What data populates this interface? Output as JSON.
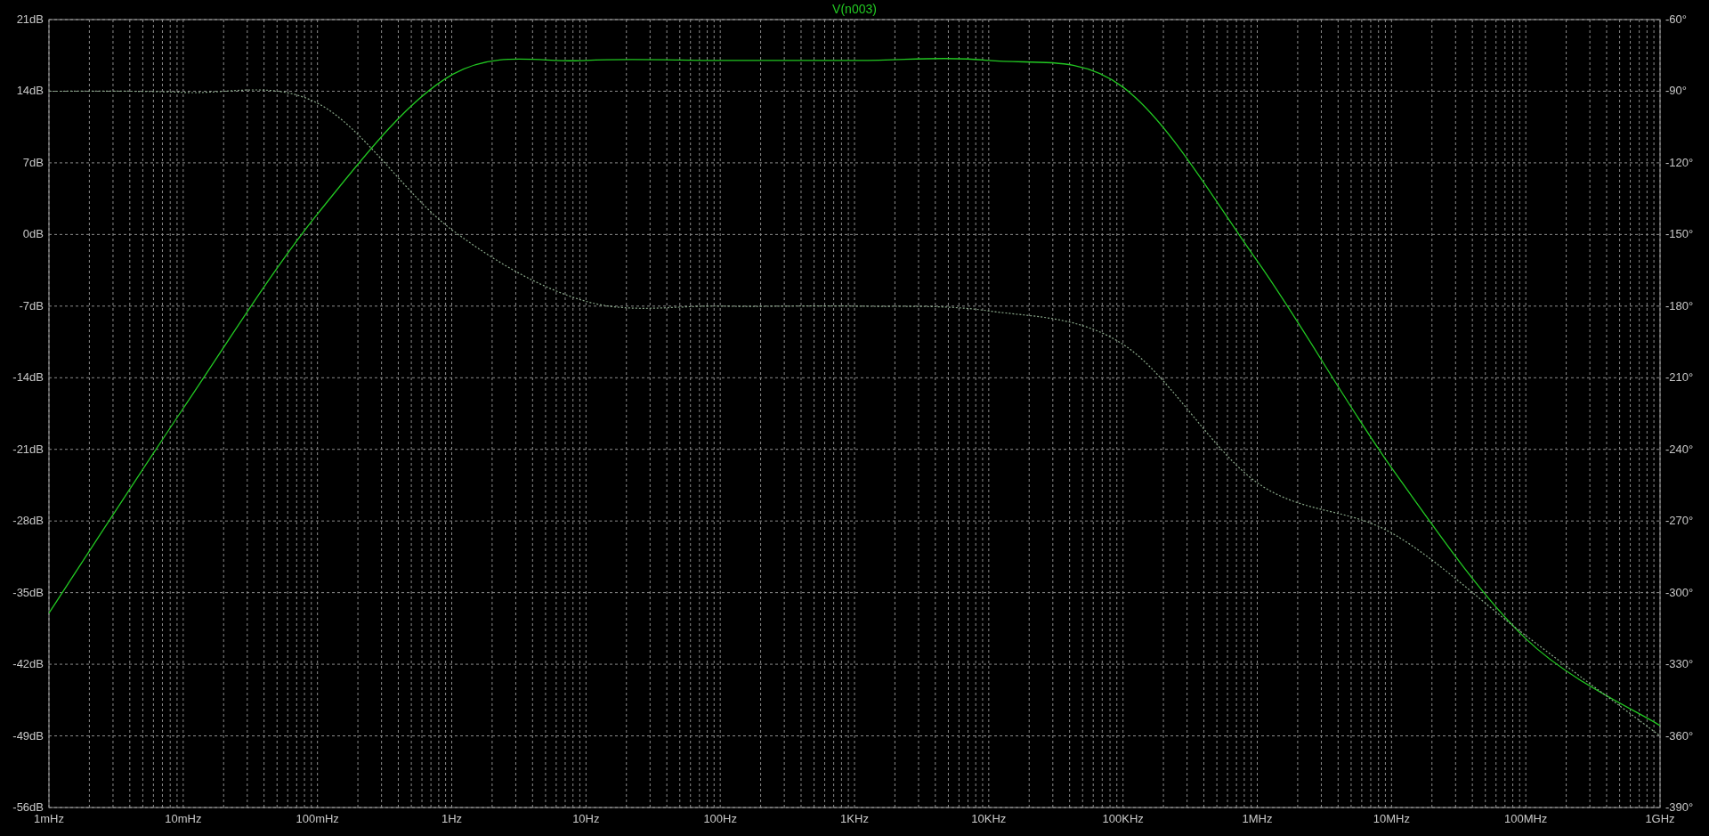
{
  "plot": {
    "chart_data": {
      "type": "line",
      "grid": true,
      "categories": [
        "1mHz",
        "10mHz",
        "100mHz",
        "1Hz",
        "10Hz",
        "100Hz",
        "1KHz",
        "10KHz",
        "100KHz",
        "1MHz",
        "10MHz",
        "100MHz",
        "1GHz"
      ],
      "ylim": [
        -56,
        21
      ],
      "series": [
        {
          "name": "V(n003)",
          "color": "#22c822",
          "values": [
            -37,
            -17,
            2,
            15.6,
            17,
            17,
            17,
            17,
            14.4,
            -2.6,
            -22.8,
            -39.5,
            -48
          ]
        }
      ],
      "yticks": [
        {
          "value": 21,
          "label": "21dB"
        },
        {
          "value": 14,
          "label": "14dB"
        },
        {
          "value": 7,
          "label": "7dB"
        },
        {
          "value": 0,
          "label": "0dB"
        },
        {
          "value": -7,
          "label": "-7dB"
        },
        {
          "value": -14,
          "label": "-14dB"
        },
        {
          "value": -21,
          "label": "-21dB"
        },
        {
          "value": -28,
          "label": "-28dB"
        },
        {
          "value": -35,
          "label": "-35dB"
        },
        {
          "value": -42,
          "label": "-42dB"
        },
        {
          "value": -49,
          "label": "-49dB"
        },
        {
          "value": -56,
          "label": "-56dB"
        }
      ]
    }
  },
  "phase": {
    "chart_data": {
      "type": "line",
      "ylim": [
        -390,
        -60
      ],
      "series": [
        {
          "color": "#8aa88a",
          "line_style": "dotted",
          "values": [
            -90,
            -90.5,
            -95,
            -148,
            -178,
            -180,
            -180,
            -182,
            -196,
            -254,
            -275,
            -318,
            -360
          ]
        }
      ],
      "yticks": [
        {
          "value": -60,
          "label": "-60°"
        },
        {
          "value": -90,
          "label": "-90°"
        },
        {
          "value": -120,
          "label": "-120°"
        },
        {
          "value": -150,
          "label": "-150°"
        },
        {
          "value": -180,
          "label": "-180°"
        },
        {
          "value": -210,
          "label": "-210°"
        },
        {
          "value": -240,
          "label": "-240°"
        },
        {
          "value": -270,
          "label": "-270°"
        },
        {
          "value": -300,
          "label": "-300°"
        },
        {
          "value": -330,
          "label": "-330°"
        },
        {
          "value": -360,
          "label": "-360°"
        },
        {
          "value": -390,
          "label": "-390°"
        }
      ]
    }
  }
}
